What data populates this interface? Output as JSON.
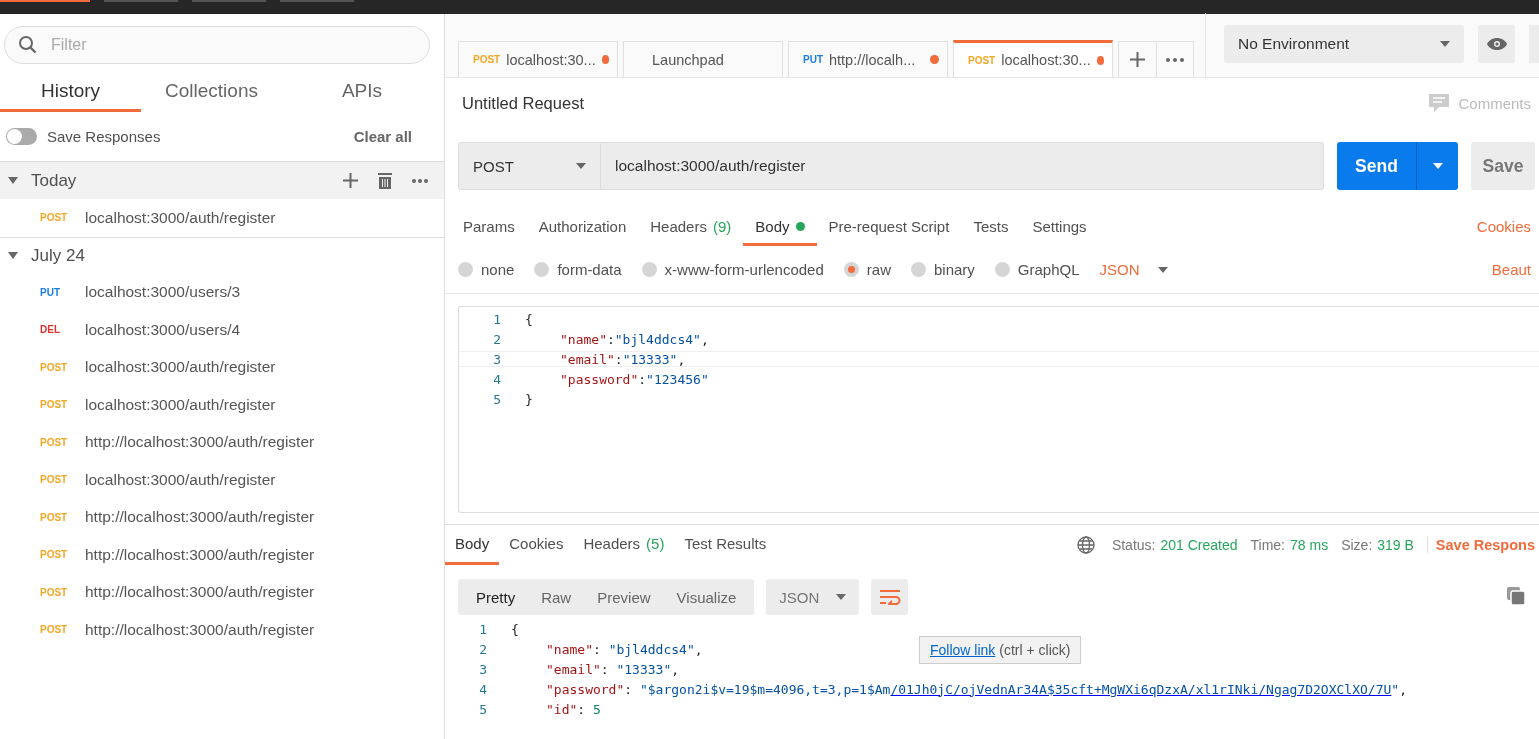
{
  "sidebar": {
    "filter": {
      "placeholder": "Filter"
    },
    "tabs": [
      {
        "label": "History",
        "selected": true
      },
      {
        "label": "Collections",
        "selected": false
      },
      {
        "label": "APIs",
        "selected": false
      }
    ],
    "save_responses": {
      "label": "Save Responses",
      "on": false
    },
    "clear_all": "Clear all",
    "groups": [
      {
        "title": "Today",
        "expanded": true,
        "actions": true,
        "items": [
          {
            "method": "POST",
            "color": "#f5a623",
            "url": "localhost:3000/auth/register"
          }
        ]
      },
      {
        "title": "July 24",
        "expanded": true,
        "actions": false,
        "items": [
          {
            "method": "PUT",
            "color": "#1a7ee0",
            "url": "localhost:3000/users/3"
          },
          {
            "method": "DEL",
            "color": "#e03131",
            "url": "localhost:3000/users/4"
          },
          {
            "method": "POST",
            "color": "#f5a623",
            "url": "localhost:3000/auth/register"
          },
          {
            "method": "POST",
            "color": "#f5a623",
            "url": "localhost:3000/auth/register"
          },
          {
            "method": "POST",
            "color": "#f5a623",
            "url": "http://localhost:3000/auth/register"
          },
          {
            "method": "POST",
            "color": "#f5a623",
            "url": "localhost:3000/auth/register"
          },
          {
            "method": "POST",
            "color": "#f5a623",
            "url": "http://localhost:3000/auth/register"
          },
          {
            "method": "POST",
            "color": "#f5a623",
            "url": "http://localhost:3000/auth/register"
          },
          {
            "method": "POST",
            "color": "#f5a623",
            "url": "http://localhost:3000/auth/register"
          },
          {
            "method": "POST",
            "color": "#f5a623",
            "url": "http://localhost:3000/auth/register"
          }
        ]
      }
    ]
  },
  "request_tabs": [
    {
      "method": "POST",
      "color": "#f5a623",
      "label": "localhost:30...",
      "modified": true,
      "selected": false
    },
    {
      "label": "Launchpad",
      "modified": false,
      "selected": false
    },
    {
      "method": "PUT",
      "color": "#1a7ee0",
      "label": "http://localh...",
      "modified": true,
      "selected": false
    },
    {
      "method": "POST",
      "color": "#f5a623",
      "label": "localhost:30...",
      "modified": true,
      "selected": true
    }
  ],
  "environment": {
    "value": "No Environment"
  },
  "request": {
    "title": "Untitled Request",
    "comments": "Comments",
    "method": "POST",
    "url": "localhost:3000/auth/register",
    "send": "Send",
    "save": "Save",
    "tabs": [
      {
        "label": "Params",
        "selected": false
      },
      {
        "label": "Authorization",
        "selected": false
      },
      {
        "label": "Headers",
        "count": "(9)",
        "selected": false
      },
      {
        "label": "Body",
        "dot": true,
        "selected": true
      },
      {
        "label": "Pre-request Script",
        "selected": false
      },
      {
        "label": "Tests",
        "selected": false
      },
      {
        "label": "Settings",
        "selected": false
      }
    ],
    "cookies": "Cookies",
    "body_types": [
      {
        "label": "none",
        "selected": false
      },
      {
        "label": "form-data",
        "selected": false
      },
      {
        "label": "x-www-form-urlencoded",
        "selected": false
      },
      {
        "label": "raw",
        "selected": true
      },
      {
        "label": "binary",
        "selected": false
      },
      {
        "label": "GraphQL",
        "selected": false
      }
    ],
    "format": "JSON",
    "beautify": "Beaut",
    "code": [
      {
        "number": "1",
        "indented": false,
        "highlighted": false,
        "tokens": [
          {
            "kind": "punct",
            "text": "{"
          }
        ]
      },
      {
        "number": "2",
        "indented": true,
        "highlighted": false,
        "tokens": [
          {
            "kind": "key",
            "text": "\"name\""
          },
          {
            "kind": "punct",
            "text": ":"
          },
          {
            "kind": "str",
            "text": "\"bjl4ddcs4\""
          },
          {
            "kind": "punct",
            "text": ","
          }
        ]
      },
      {
        "number": "3",
        "indented": true,
        "highlighted": true,
        "tokens": [
          {
            "kind": "key",
            "text": "\"email\""
          },
          {
            "kind": "punct",
            "text": ":"
          },
          {
            "kind": "str",
            "text": "\"13333\""
          },
          {
            "kind": "punct",
            "text": ","
          }
        ]
      },
      {
        "number": "4",
        "indented": true,
        "highlighted": false,
        "tokens": [
          {
            "kind": "key",
            "text": "\"password\""
          },
          {
            "kind": "punct",
            "text": ":"
          },
          {
            "kind": "str",
            "text": "\"123456\""
          }
        ]
      },
      {
        "number": "5",
        "indented": false,
        "highlighted": false,
        "tokens": [
          {
            "kind": "punct",
            "text": "}"
          }
        ]
      }
    ]
  },
  "response": {
    "tabs": [
      {
        "label": "Body",
        "selected": true
      },
      {
        "label": "Cookies",
        "selected": false
      },
      {
        "label": "Headers",
        "count": "(5)",
        "selected": false
      },
      {
        "label": "Test Results",
        "selected": false
      }
    ],
    "status_label": "Status:",
    "status": "201 Created",
    "time_label": "Time:",
    "time": "78 ms",
    "size_label": "Size:",
    "size": "319 B",
    "save_response": "Save Respons",
    "views": [
      {
        "label": "Pretty",
        "selected": true
      },
      {
        "label": "Raw",
        "selected": false
      },
      {
        "label": "Preview",
        "selected": false
      },
      {
        "label": "Visualize",
        "selected": false
      }
    ],
    "format": "JSON",
    "code": [
      {
        "number": "1",
        "indented": false,
        "tokens": [
          {
            "kind": "punct",
            "text": "{"
          }
        ]
      },
      {
        "number": "2",
        "indented": true,
        "tokens": [
          {
            "kind": "key",
            "text": "\"name\""
          },
          {
            "kind": "punct",
            "text": ": "
          },
          {
            "kind": "str",
            "text": "\"bjl4ddcs4\""
          },
          {
            "kind": "punct",
            "text": ","
          }
        ]
      },
      {
        "number": "3",
        "indented": true,
        "tokens": [
          {
            "kind": "key",
            "text": "\"email\""
          },
          {
            "kind": "punct",
            "text": ": "
          },
          {
            "kind": "str",
            "text": "\"13333\""
          },
          {
            "kind": "punct",
            "text": ","
          }
        ]
      },
      {
        "number": "4",
        "indented": true,
        "tokens": [
          {
            "kind": "key",
            "text": "\"password\""
          },
          {
            "kind": "punct",
            "text": ": "
          },
          {
            "kind": "str",
            "text": "\"$argon2i$v=19$m=4096,t=3,p=1$Am"
          },
          {
            "kind": "link",
            "text": "/01Jh0jC/ojVednAr34A$35cft+MgWXi6qDzxA/xl1rINki/Ngag7D2OXClXO/7U"
          },
          {
            "kind": "str",
            "text": "\""
          },
          {
            "kind": "punct",
            "text": ","
          }
        ]
      },
      {
        "number": "5",
        "indented": true,
        "tokens": [
          {
            "kind": "key",
            "text": "\"id\""
          },
          {
            "kind": "punct",
            "text": ": "
          },
          {
            "kind": "num",
            "text": "5"
          }
        ]
      }
    ],
    "tooltip": {
      "link": "Follow link",
      "hint": "(ctrl + click)"
    }
  }
}
